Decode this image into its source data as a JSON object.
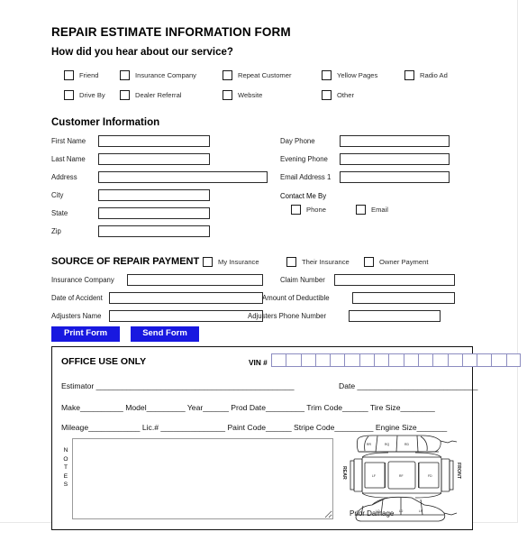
{
  "form": {
    "title": "REPAIR ESTIMATE INFORMATION FORM",
    "subtitle": "How did you hear about our service?"
  },
  "referral": {
    "row1": [
      {
        "label": "Friend",
        "checked": false
      },
      {
        "label": "Insurance Company",
        "checked": false
      },
      {
        "label": "Repeat Customer",
        "checked": false
      },
      {
        "label": "Yellow Pages",
        "checked": false
      },
      {
        "label": "Radio Ad",
        "checked": false
      }
    ],
    "row2": [
      {
        "label": "Drive By",
        "checked": false
      },
      {
        "label": "Dealer Referral",
        "checked": false
      },
      {
        "label": "Website",
        "checked": false
      },
      {
        "label": "Other",
        "checked": false
      }
    ]
  },
  "customer": {
    "heading": "Customer Information",
    "left_fields": [
      {
        "label": "First Name",
        "value": ""
      },
      {
        "label": "Last Name",
        "value": ""
      },
      {
        "label": "Address",
        "value": ""
      },
      {
        "label": "City",
        "value": ""
      },
      {
        "label": "State",
        "value": ""
      },
      {
        "label": "Zip",
        "value": ""
      }
    ],
    "right_fields": [
      {
        "label": "Day Phone",
        "value": ""
      },
      {
        "label": "Evening Phone",
        "value": ""
      },
      {
        "label": "Email Address 1",
        "value": ""
      }
    ],
    "contact_me_by": {
      "label": "Contact Me By",
      "options": [
        {
          "label": "Phone",
          "checked": false
        },
        {
          "label": "Email",
          "checked": false
        }
      ]
    }
  },
  "payment": {
    "heading": "SOURCE OF REPAIR PAYMENT",
    "options": [
      {
        "label": "My Insurance",
        "checked": false
      },
      {
        "label": "Their Insurance",
        "checked": false
      },
      {
        "label": "Owner Payment",
        "checked": false
      }
    ],
    "left_fields": [
      {
        "label": "Insurance Company",
        "value": ""
      },
      {
        "label": "Date of Accident",
        "value": ""
      },
      {
        "label": "Adjusters Name",
        "value": ""
      }
    ],
    "right_fields": [
      {
        "label": "Claim Number",
        "value": ""
      },
      {
        "label": "Amount of Deductible",
        "value": ""
      },
      {
        "label": "Adjusters Phone Number",
        "value": ""
      }
    ]
  },
  "actions": {
    "print_label": "Print Form",
    "send_label": "Send Form",
    "button_color": "#1818e0"
  },
  "office": {
    "heading": "OFFICE USE ONLY",
    "vin_label": "VIN #",
    "vin_cells": 17,
    "line_estimator": "Estimator ______________________________________________",
    "line_date": "Date ____________________________",
    "line_vehicle": "Make__________   Model_________   Year______   Prod Date_________   Trim Code______   Tire Size________",
    "line_vehicle2": "Mileage____________   Lic.# _______________   Paint Code______   Stripe Code_________   Engine Size_______",
    "notes_label": "NOTES",
    "prior_damage_label": "Prior Damage",
    "diagram_front_label": "FRONT",
    "diagram_rear_label": "REAR"
  }
}
